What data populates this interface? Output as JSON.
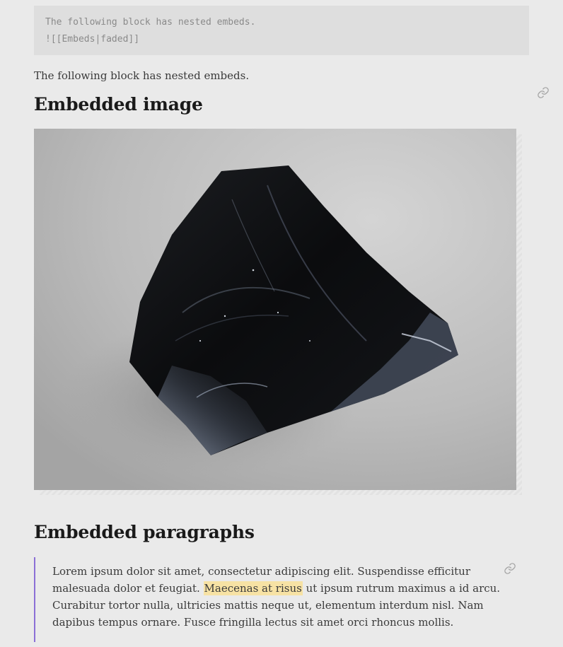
{
  "code_block": {
    "line1": "The following block has nested embeds.",
    "line2": "![[Embeds|faded]]"
  },
  "intro": "The following block has nested embeds.",
  "sections": {
    "image": {
      "heading": "Embedded image",
      "image_alt": "Obsidian rock on grey background"
    },
    "paragraphs": {
      "heading": "Embedded paragraphs",
      "text_before": "Lorem ipsum dolor sit amet, consectetur adipiscing elit. Suspendisse efficitur malesuada dolor et feugiat. ",
      "highlight": "Maecenas at risus",
      "text_after": " ut ipsum rutrum maximus a id arcu. Curabitur tortor nulla, ultricies mattis neque ut, elementum interdum nisl. Nam dapibus tempus ornare. Fusce fringilla lectus sit amet orci rhoncus mollis."
    }
  },
  "icons": {
    "link": "link-icon"
  },
  "colors": {
    "background": "#eaeaea",
    "code_background": "#dedede",
    "quote_border": "#8b6fd6",
    "highlight": "#f7e2a4"
  }
}
